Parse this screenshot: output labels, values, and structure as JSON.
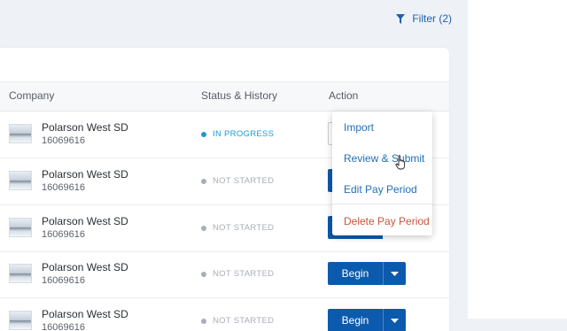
{
  "filter": {
    "label": "Filter (2)",
    "icon": "funnel-icon"
  },
  "table": {
    "columns": [
      "Company",
      "Status & History",
      "Action"
    ],
    "rows": [
      {
        "name": "Polarson West SD",
        "id": "16069616",
        "status": "IN PROGRESS",
        "action": ""
      },
      {
        "name": "Polarson West SD",
        "id": "16069616",
        "status": "NOT STARTED",
        "action": ""
      },
      {
        "name": "Polarson West SD",
        "id": "16069616",
        "status": "NOT STARTED",
        "action": ""
      },
      {
        "name": "Polarson West SD",
        "id": "16069616",
        "status": "NOT STARTED",
        "action": "Begin"
      },
      {
        "name": "Polarson West SD",
        "id": "16069616",
        "status": "NOT STARTED",
        "action": "Begin"
      }
    ]
  },
  "dropdown_menu": {
    "items": [
      "Import",
      "Review & Submit",
      "Edit Pay Period",
      "Delete Pay Period"
    ]
  },
  "colors": {
    "accent": "#0c5aad",
    "link": "#1f6fb8",
    "in_progress": "#1a9ad6",
    "not_started": "#a9aeb6",
    "danger": "#c8553d"
  }
}
